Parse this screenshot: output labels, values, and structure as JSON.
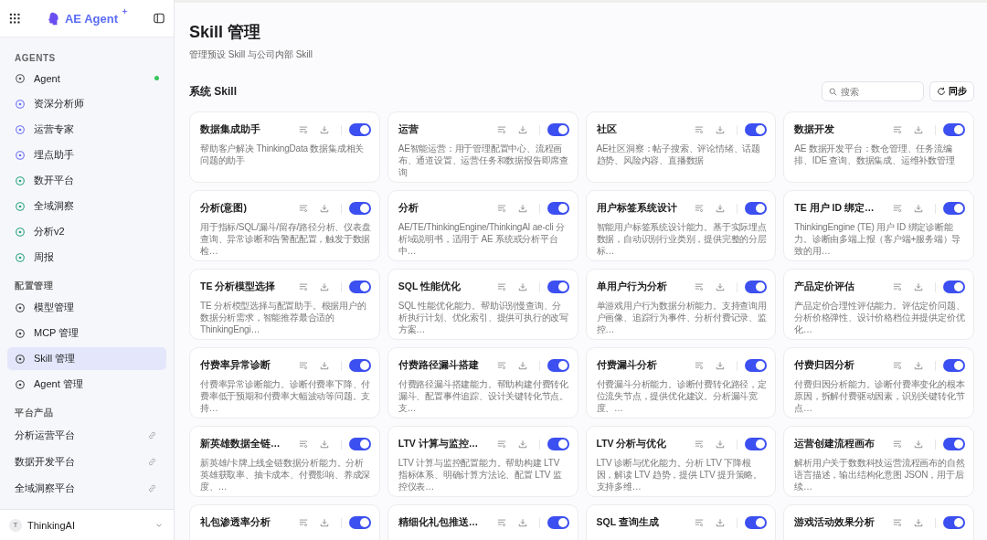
{
  "sidebar": {
    "brand": "AE Agent",
    "sections": [
      {
        "title": "AGENTS",
        "items": [
          {
            "label": "Agent",
            "selected": false,
            "online": true
          },
          {
            "label": "资深分析师",
            "selected": false,
            "online": false
          },
          {
            "label": "运营专家",
            "selected": false,
            "online": false
          },
          {
            "label": "埋点助手",
            "selected": false,
            "online": false
          },
          {
            "label": "数开平台",
            "selected": false,
            "online": false
          },
          {
            "label": "全域洞察",
            "selected": false,
            "online": false
          },
          {
            "label": "分析v2",
            "selected": false,
            "online": false
          },
          {
            "label": "周报",
            "selected": false,
            "online": false
          }
        ]
      },
      {
        "title": "配置管理",
        "items": [
          {
            "label": "模型管理",
            "selected": false,
            "online": false
          },
          {
            "label": "MCP 管理",
            "selected": false,
            "online": false
          },
          {
            "label": "Skill 管理",
            "selected": true,
            "online": false
          },
          {
            "label": "Agent 管理",
            "selected": false,
            "online": false
          }
        ]
      }
    ],
    "platform": {
      "title": "平台产品",
      "links": [
        "分析运营平台",
        "数据开发平台",
        "全域洞察平台"
      ]
    },
    "user": {
      "initial": "T",
      "name": "ThinkingAI"
    }
  },
  "page": {
    "title": "Skill 管理",
    "subtitle": "管理预设 Skill 与公司内部 Skill"
  },
  "section": {
    "title": "系统 Skill",
    "search_placeholder": "搜索",
    "sync_label": "同步"
  },
  "cards": [
    {
      "title": "数据集成助手",
      "description": "帮助客户解决 ThinkingData 数据集成相关问题的助手",
      "on": true
    },
    {
      "title": "运营",
      "description": "AE智能运营：用于管理配置中心、流程画布、通道设置、运营任务和数据报告即席查询",
      "on": true
    },
    {
      "title": "社区",
      "description": "AE社区洞察：帖子搜索、评论情绪、话题趋势、风险内容、直播数据",
      "on": true
    },
    {
      "title": "数据开发",
      "description": "AE 数据开发平台：数仓管理、任务流编排、IDE 查询、数据集成、运维补数管理",
      "on": true
    },
    {
      "title": "分析(意图)",
      "description": "用于指标/SQL/漏斗/留存/路径分析、仪表盘查询、异常诊断和告警配配置，触发于数据检…",
      "on": true
    },
    {
      "title": "分析",
      "description": "AE/TE/ThinkingEngine/ThinkingAI ae-cli 分析域说明书，适用于 AE 系统或分析平台中…",
      "on": true
    },
    {
      "title": "用户标签系统设计",
      "description": "智能用户标签系统设计能力。基于实际埋点数据，自动识别行业类别，提供完整的分层标…",
      "on": true
    },
    {
      "title": "TE 用户 ID 绑定…",
      "description": "ThinkingEngine (TE) 用户 ID 绑定诊断能力。诊断由多端上报（客户端+服务端）导致的用…",
      "on": true
    },
    {
      "title": "TE 分析模型选择",
      "description": "TE 分析模型选择与配置助手。根据用户的数据分析需求，智能推荐最合适的 ThinkingEngi…",
      "on": true
    },
    {
      "title": "SQL 性能优化",
      "description": "SQL 性能优化能力。帮助识别慢查询、分析执行计划、优化索引、提供可执行的改写方案…",
      "on": true
    },
    {
      "title": "单用户行为分析",
      "description": "单游戏用户行为数据分析能力。支持查询用户画像、追踪行为事件、分析付费记录、监控…",
      "on": true
    },
    {
      "title": "产品定价评估",
      "description": "产品定价合理性评估能力。评估定价问题、分析价格弹性、设计价格档位并提供定价优化…",
      "on": true
    },
    {
      "title": "付费率异常诊断",
      "description": "付费率异常诊断能力。诊断付费率下降、付费率低于预期和付费率大幅波动等问题。支持…",
      "on": true
    },
    {
      "title": "付费路径漏斗搭建",
      "description": "付费路径漏斗搭建能力。帮助构建付费转化漏斗、配置事件追踪、设计关键转化节点。支…",
      "on": true
    },
    {
      "title": "付费漏斗分析",
      "description": "付费漏斗分析能力。诊断付费转化路径，定位流失节点，提供优化建议。分析漏斗宽度、…",
      "on": true
    },
    {
      "title": "付费归因分析",
      "description": "付费归因分析能力。诊断付费率变化的根本原因，拆解付费驱动因素，识别关键转化节点…",
      "on": true
    },
    {
      "title": "新英雄数据全链…",
      "description": "新英雄/卡牌上线全链数据分析能力。分析英雄获取率、抽卡成本、付费影响、养成深度、…",
      "on": true
    },
    {
      "title": "LTV 计算与监控…",
      "description": "LTV 计算与监控配置能力。帮助构建 LTV 指标体系、明确计算方法论、配置 LTV 监控仪表…",
      "on": true
    },
    {
      "title": "LTV 分析与优化",
      "description": "LTV 诊断与优化能力。分析 LTV 下降根因，解读 LTV 趋势，提供 LTV 提升策略。支持多维…",
      "on": true
    },
    {
      "title": "运营创建流程画布",
      "description": "解析用户关于数数科技运营流程画布的自然语言描述，输出结构化意图 JSON，用于后续…",
      "on": true
    },
    {
      "title": "礼包渗透率分析",
      "on": true
    },
    {
      "title": "精细化礼包推送…",
      "on": true
    },
    {
      "title": "SQL 查询生成",
      "on": true
    },
    {
      "title": "游戏活动效果分析",
      "on": true
    }
  ]
}
